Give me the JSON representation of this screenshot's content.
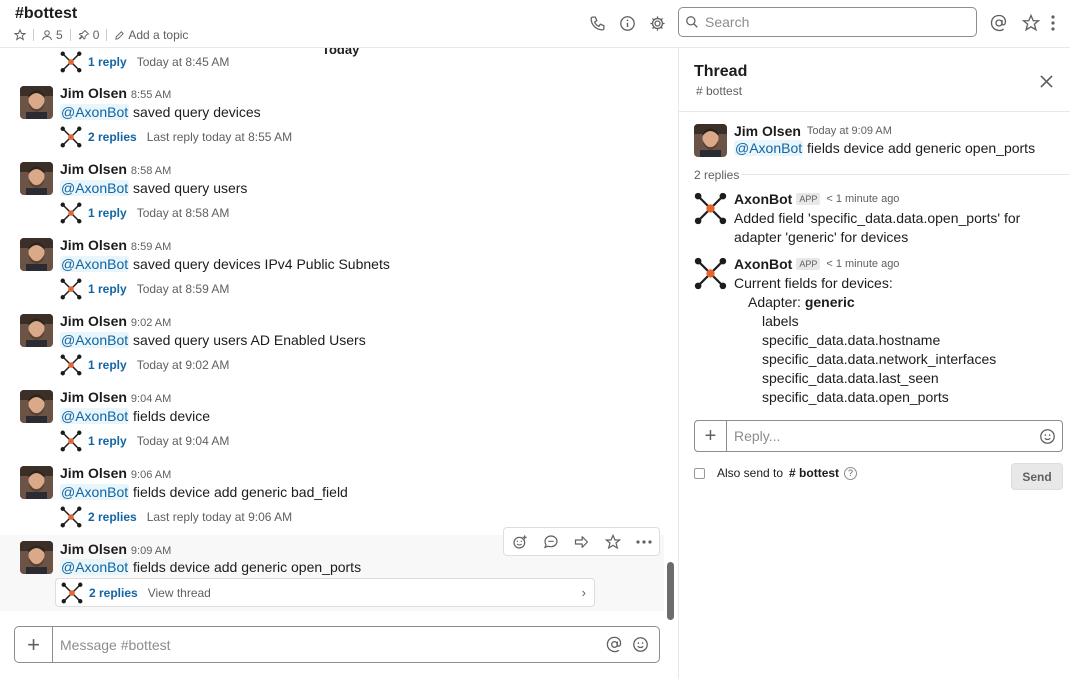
{
  "header": {
    "channel_name": "#bottest",
    "members_count": "5",
    "pins_count": "0",
    "add_topic_label": "Add a topic",
    "search_placeholder": "Search"
  },
  "divider": {
    "label": "Today"
  },
  "top_partial": {
    "replies_label": "1 reply",
    "meta": "Today at 8:45 AM"
  },
  "messages": [
    {
      "author": "Jim Olsen",
      "time": "8:55 AM",
      "mention": "@AxonBot",
      "text": "saved query devices",
      "replies_label": "2 replies",
      "replies_meta": "Last reply today at 8:55 AM"
    },
    {
      "author": "Jim Olsen",
      "time": "8:58 AM",
      "mention": "@AxonBot",
      "text": "saved query users",
      "replies_label": "1 reply",
      "replies_meta": "Today at 8:58 AM"
    },
    {
      "author": "Jim Olsen",
      "time": "8:59 AM",
      "mention": "@AxonBot",
      "text": "saved query devices IPv4 Public Subnets",
      "replies_label": "1 reply",
      "replies_meta": "Today at 8:59 AM"
    },
    {
      "author": "Jim Olsen",
      "time": "9:02 AM",
      "mention": "@AxonBot",
      "text": "saved query users AD Enabled Users",
      "replies_label": "1 reply",
      "replies_meta": "Today at 9:02 AM"
    },
    {
      "author": "Jim Olsen",
      "time": "9:04 AM",
      "mention": "@AxonBot",
      "text": "fields device",
      "replies_label": "1 reply",
      "replies_meta": "Today at 9:04 AM"
    },
    {
      "author": "Jim Olsen",
      "time": "9:06 AM",
      "mention": "@AxonBot",
      "text": "fields device add generic bad_field",
      "replies_label": "2 replies",
      "replies_meta": "Last reply today at 9:06 AM"
    },
    {
      "author": "Jim Olsen",
      "time": "9:09 AM",
      "mention": "@AxonBot",
      "text": "fields device add generic open_ports",
      "replies_label": "2 replies",
      "replies_meta": "View thread"
    }
  ],
  "composer": {
    "placeholder": "Message #bottest"
  },
  "thread": {
    "title": "Thread",
    "channel": "# bottest",
    "parent": {
      "author": "Jim Olsen",
      "time": "Today at 9:09 AM",
      "mention": "@AxonBot",
      "text": "fields device add generic open_ports"
    },
    "replies_count": "2 replies",
    "reply1": {
      "author": "AxonBot",
      "badge": "APP",
      "time": "< 1 minute ago",
      "text": "Added field 'specific_data.data.open_ports' for adapter 'generic' for devices"
    },
    "reply2": {
      "author": "AxonBot",
      "badge": "APP",
      "time": "< 1 minute ago",
      "intro": "Current fields for devices:",
      "adapter_label": "Adapter:",
      "adapter_name": "generic",
      "fields": [
        "labels",
        "specific_data.data.hostname",
        "specific_data.data.network_interfaces",
        "specific_data.data.last_seen",
        "specific_data.data.open_ports"
      ]
    },
    "reply_placeholder": "Reply...",
    "also_send_label": "Also send to",
    "also_send_channel": "# bottest",
    "send_label": "Send"
  },
  "colors": {
    "link": "#1264a3",
    "mention_bg": "#e8f5fa",
    "bot_orange": "#e8622c"
  }
}
